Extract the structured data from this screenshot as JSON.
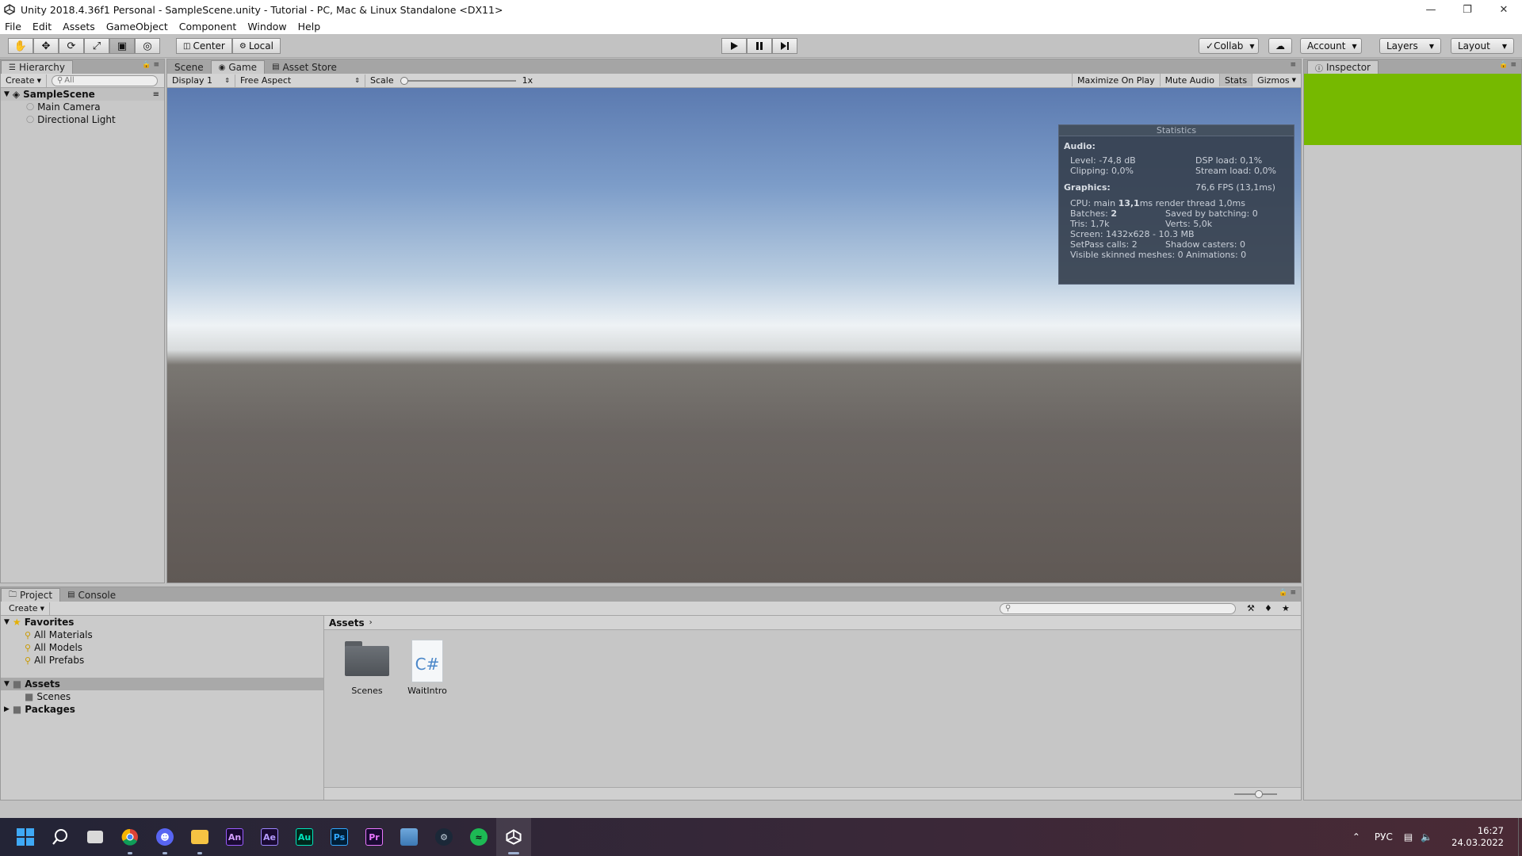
{
  "window": {
    "title": "Unity 2018.4.36f1 Personal - SampleScene.unity - Tutorial - PC, Mac & Linux Standalone <DX11>",
    "controls": [
      "minimize",
      "restore",
      "close"
    ]
  },
  "menu": [
    "File",
    "Edit",
    "Assets",
    "GameObject",
    "Component",
    "Window",
    "Help"
  ],
  "toolbar": {
    "tools": [
      "hand-icon",
      "move-icon",
      "rotate-icon",
      "scale-icon",
      "rect-icon",
      "transform-icon"
    ],
    "pivot_center": "Center",
    "pivot_local": "Local",
    "collab": "Collab",
    "account": "Account",
    "layers": "Layers",
    "layout": "Layout"
  },
  "hierarchy": {
    "tab": "Hierarchy",
    "create": "Create",
    "search_placeholder": "All",
    "scene": "SampleScene",
    "items": [
      "Main Camera",
      "Directional Light"
    ]
  },
  "game": {
    "tabs": [
      "Scene",
      "Game",
      "Asset Store"
    ],
    "display": "Display 1",
    "aspect": "Free Aspect",
    "scale_label": "Scale",
    "scale_value": "1x",
    "toggles": [
      "Maximize On Play",
      "Mute Audio",
      "Stats",
      "Gizmos"
    ]
  },
  "stats": {
    "title": "Statistics",
    "audio_label": "Audio:",
    "level": "Level: -74,8 dB",
    "dsp": "DSP load: 0,1%",
    "clipping": "Clipping: 0,0%",
    "stream": "Stream load: 0,0%",
    "graphics_label": "Graphics:",
    "fps": "76,6 FPS (13,1ms)",
    "cpu_prefix": "CPU: main ",
    "cpu_main": "13,1",
    "cpu_suffix": "ms  render thread 1,0ms",
    "batches_prefix": "Batches: ",
    "batches": "2",
    "saved": "Saved by batching: 0",
    "tris": "Tris: 1,7k",
    "verts": "Verts: 5,0k",
    "screen": "Screen: 1432x628 - 10.3 MB",
    "setpass": "SetPass calls: 2",
    "shadow": "Shadow casters: 0",
    "skinned": "Visible skinned meshes: 0  Animations: 0"
  },
  "inspector": {
    "tab": "Inspector"
  },
  "project": {
    "tabs": [
      "Project",
      "Console"
    ],
    "create": "Create",
    "favorites_label": "Favorites",
    "favorites": [
      "All Materials",
      "All Models",
      "All Prefabs"
    ],
    "assets_label": "Assets",
    "asset_children": [
      "Scenes"
    ],
    "packages_label": "Packages",
    "breadcrumb": "Assets",
    "items": [
      {
        "name": "Scenes",
        "kind": "folder"
      },
      {
        "name": "WaitIntro",
        "kind": "csharp"
      }
    ],
    "csharp_glyph": "C#"
  },
  "taskbar": {
    "apps": [
      {
        "id": "start",
        "label": ""
      },
      {
        "id": "search",
        "label": ""
      },
      {
        "id": "taskview",
        "label": ""
      },
      {
        "id": "chrome",
        "label": ""
      },
      {
        "id": "discord",
        "label": ""
      },
      {
        "id": "explorer",
        "label": ""
      },
      {
        "id": "animate",
        "label": "An"
      },
      {
        "id": "aftereffects",
        "label": "Ae"
      },
      {
        "id": "audition",
        "label": "Au"
      },
      {
        "id": "photoshop",
        "label": "Ps"
      },
      {
        "id": "premiere",
        "label": "Pr"
      },
      {
        "id": "photos",
        "label": ""
      },
      {
        "id": "steam",
        "label": ""
      },
      {
        "id": "spotify",
        "label": ""
      },
      {
        "id": "unity",
        "label": ""
      }
    ],
    "lang": "РУС",
    "time": "16:27",
    "date": "24.03.2022"
  },
  "colors": {
    "inspector_green": "#76b900",
    "stats_bg": "#343e4c"
  }
}
